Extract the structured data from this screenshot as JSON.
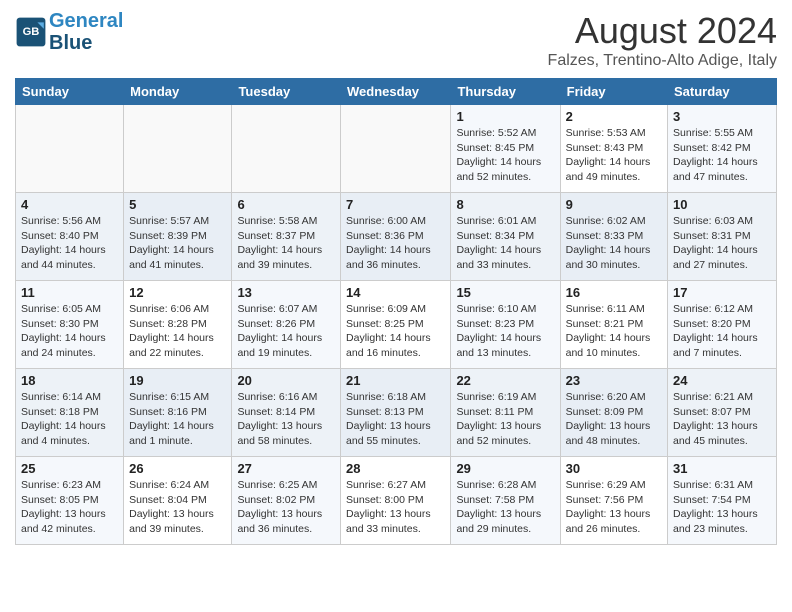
{
  "header": {
    "logo_line1": "General",
    "logo_line2": "Blue",
    "month": "August 2024",
    "location": "Falzes, Trentino-Alto Adige, Italy"
  },
  "days_of_week": [
    "Sunday",
    "Monday",
    "Tuesday",
    "Wednesday",
    "Thursday",
    "Friday",
    "Saturday"
  ],
  "weeks": [
    [
      {
        "day": "",
        "info": ""
      },
      {
        "day": "",
        "info": ""
      },
      {
        "day": "",
        "info": ""
      },
      {
        "day": "",
        "info": ""
      },
      {
        "day": "1",
        "info": "Sunrise: 5:52 AM\nSunset: 8:45 PM\nDaylight: 14 hours and 52 minutes."
      },
      {
        "day": "2",
        "info": "Sunrise: 5:53 AM\nSunset: 8:43 PM\nDaylight: 14 hours and 49 minutes."
      },
      {
        "day": "3",
        "info": "Sunrise: 5:55 AM\nSunset: 8:42 PM\nDaylight: 14 hours and 47 minutes."
      }
    ],
    [
      {
        "day": "4",
        "info": "Sunrise: 5:56 AM\nSunset: 8:40 PM\nDaylight: 14 hours and 44 minutes."
      },
      {
        "day": "5",
        "info": "Sunrise: 5:57 AM\nSunset: 8:39 PM\nDaylight: 14 hours and 41 minutes."
      },
      {
        "day": "6",
        "info": "Sunrise: 5:58 AM\nSunset: 8:37 PM\nDaylight: 14 hours and 39 minutes."
      },
      {
        "day": "7",
        "info": "Sunrise: 6:00 AM\nSunset: 8:36 PM\nDaylight: 14 hours and 36 minutes."
      },
      {
        "day": "8",
        "info": "Sunrise: 6:01 AM\nSunset: 8:34 PM\nDaylight: 14 hours and 33 minutes."
      },
      {
        "day": "9",
        "info": "Sunrise: 6:02 AM\nSunset: 8:33 PM\nDaylight: 14 hours and 30 minutes."
      },
      {
        "day": "10",
        "info": "Sunrise: 6:03 AM\nSunset: 8:31 PM\nDaylight: 14 hours and 27 minutes."
      }
    ],
    [
      {
        "day": "11",
        "info": "Sunrise: 6:05 AM\nSunset: 8:30 PM\nDaylight: 14 hours and 24 minutes."
      },
      {
        "day": "12",
        "info": "Sunrise: 6:06 AM\nSunset: 8:28 PM\nDaylight: 14 hours and 22 minutes."
      },
      {
        "day": "13",
        "info": "Sunrise: 6:07 AM\nSunset: 8:26 PM\nDaylight: 14 hours and 19 minutes."
      },
      {
        "day": "14",
        "info": "Sunrise: 6:09 AM\nSunset: 8:25 PM\nDaylight: 14 hours and 16 minutes."
      },
      {
        "day": "15",
        "info": "Sunrise: 6:10 AM\nSunset: 8:23 PM\nDaylight: 14 hours and 13 minutes."
      },
      {
        "day": "16",
        "info": "Sunrise: 6:11 AM\nSunset: 8:21 PM\nDaylight: 14 hours and 10 minutes."
      },
      {
        "day": "17",
        "info": "Sunrise: 6:12 AM\nSunset: 8:20 PM\nDaylight: 14 hours and 7 minutes."
      }
    ],
    [
      {
        "day": "18",
        "info": "Sunrise: 6:14 AM\nSunset: 8:18 PM\nDaylight: 14 hours and 4 minutes."
      },
      {
        "day": "19",
        "info": "Sunrise: 6:15 AM\nSunset: 8:16 PM\nDaylight: 14 hours and 1 minute."
      },
      {
        "day": "20",
        "info": "Sunrise: 6:16 AM\nSunset: 8:14 PM\nDaylight: 13 hours and 58 minutes."
      },
      {
        "day": "21",
        "info": "Sunrise: 6:18 AM\nSunset: 8:13 PM\nDaylight: 13 hours and 55 minutes."
      },
      {
        "day": "22",
        "info": "Sunrise: 6:19 AM\nSunset: 8:11 PM\nDaylight: 13 hours and 52 minutes."
      },
      {
        "day": "23",
        "info": "Sunrise: 6:20 AM\nSunset: 8:09 PM\nDaylight: 13 hours and 48 minutes."
      },
      {
        "day": "24",
        "info": "Sunrise: 6:21 AM\nSunset: 8:07 PM\nDaylight: 13 hours and 45 minutes."
      }
    ],
    [
      {
        "day": "25",
        "info": "Sunrise: 6:23 AM\nSunset: 8:05 PM\nDaylight: 13 hours and 42 minutes."
      },
      {
        "day": "26",
        "info": "Sunrise: 6:24 AM\nSunset: 8:04 PM\nDaylight: 13 hours and 39 minutes."
      },
      {
        "day": "27",
        "info": "Sunrise: 6:25 AM\nSunset: 8:02 PM\nDaylight: 13 hours and 36 minutes."
      },
      {
        "day": "28",
        "info": "Sunrise: 6:27 AM\nSunset: 8:00 PM\nDaylight: 13 hours and 33 minutes."
      },
      {
        "day": "29",
        "info": "Sunrise: 6:28 AM\nSunset: 7:58 PM\nDaylight: 13 hours and 29 minutes."
      },
      {
        "day": "30",
        "info": "Sunrise: 6:29 AM\nSunset: 7:56 PM\nDaylight: 13 hours and 26 minutes."
      },
      {
        "day": "31",
        "info": "Sunrise: 6:31 AM\nSunset: 7:54 PM\nDaylight: 13 hours and 23 minutes."
      }
    ]
  ]
}
